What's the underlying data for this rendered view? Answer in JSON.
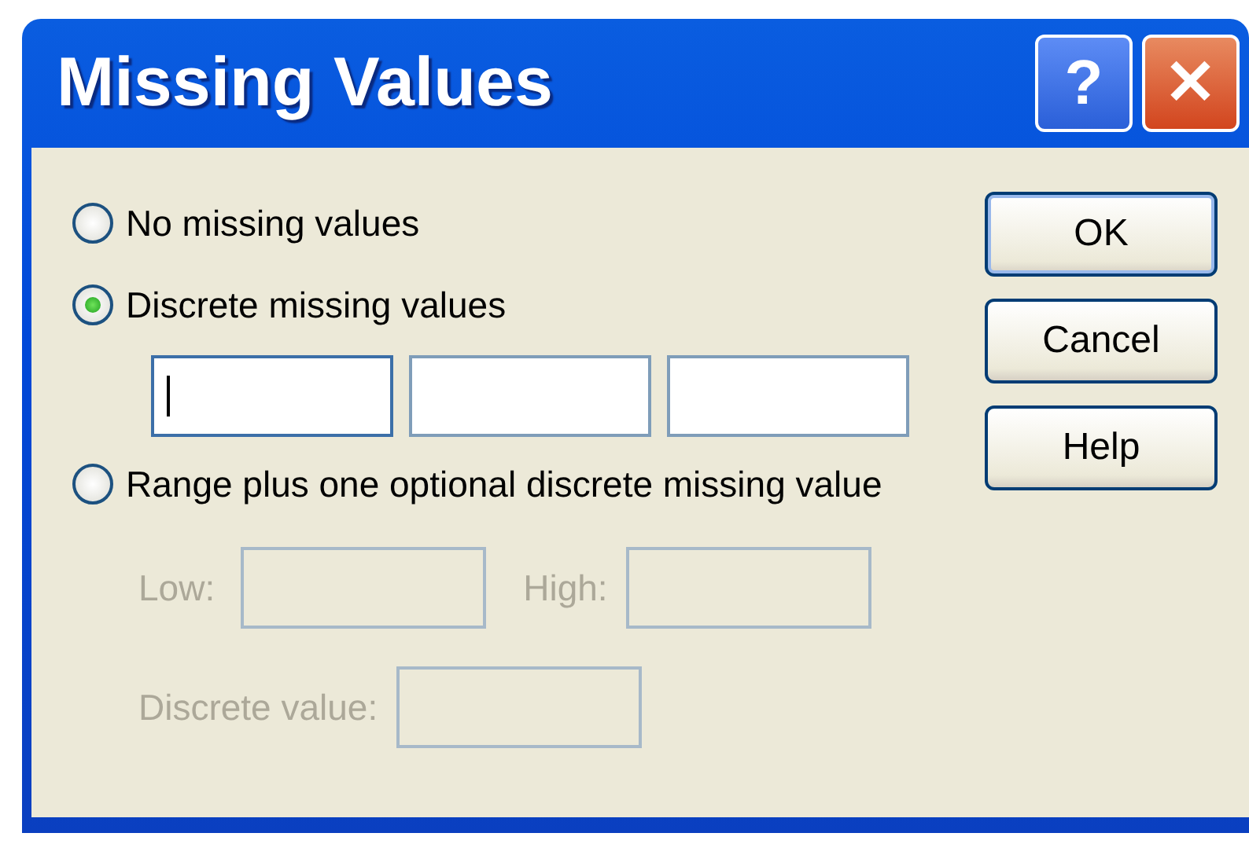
{
  "window": {
    "title": "Missing Values",
    "title_buttons": [
      {
        "kind": "help",
        "label": "?"
      },
      {
        "kind": "close",
        "label": "✕"
      }
    ]
  },
  "options": [
    {
      "label": "No missing values",
      "selected": false,
      "kind": "plain"
    },
    {
      "label": "Discrete missing values",
      "selected": true,
      "kind": "discrete",
      "fields": [
        {
          "focused": true
        },
        {
          "focused": false
        },
        {
          "focused": false
        }
      ]
    },
    {
      "label": "Range plus one optional discrete missing value",
      "selected": false,
      "kind": "range",
      "disabled": true,
      "low_label": "Low:",
      "high_label": "High:",
      "discrete_label": "Discrete value:"
    }
  ],
  "buttons": [
    "OK",
    "Cancel",
    "Help"
  ]
}
